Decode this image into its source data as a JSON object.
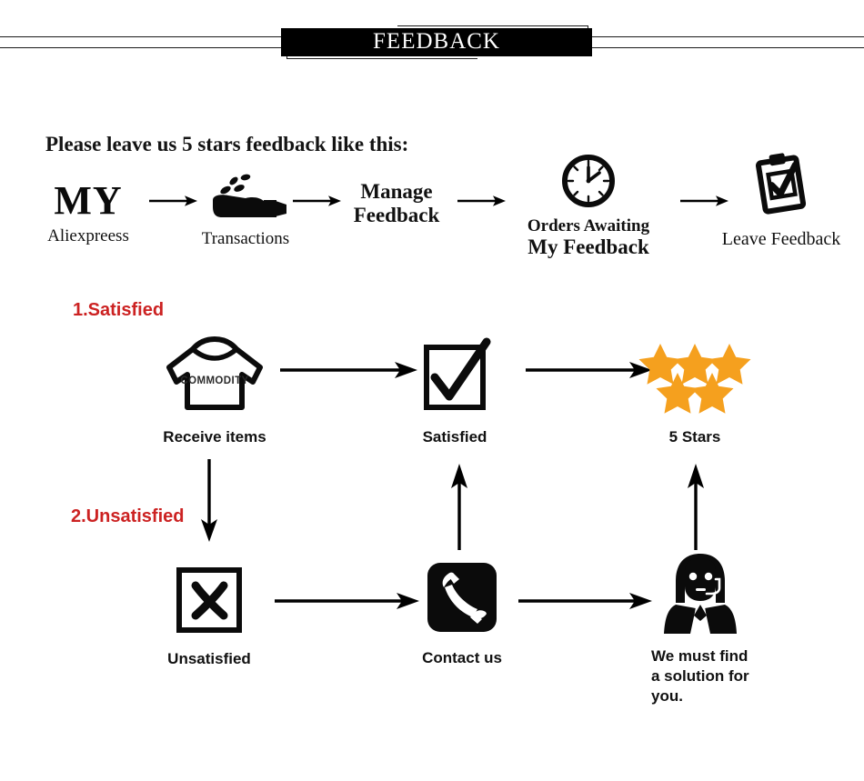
{
  "header": {
    "banner_title": "FEEDBACK"
  },
  "intro": {
    "text": "Please leave us 5 stars feedback like this:"
  },
  "top_flow": {
    "steps": [
      {
        "id": "my-aliexpreess",
        "icon": "my-text-icon",
        "title": "MY",
        "label": "Aliexpreess"
      },
      {
        "id": "transactions",
        "icon": "hand-coins-icon",
        "label": "Transactions"
      },
      {
        "id": "manage-feedback",
        "icon": "none",
        "line1": "Manage",
        "line2": "Feedback"
      },
      {
        "id": "orders-awaiting",
        "icon": "clock-icon",
        "line1": "Orders Awaiting",
        "line2": "My Feedback"
      },
      {
        "id": "leave-feedback",
        "icon": "clipboard-check-icon",
        "label": "Leave Feedback"
      }
    ]
  },
  "branches": {
    "satisfied_tag": "1.Satisfied",
    "unsatisfied_tag": "2.Unsatisfied"
  },
  "satisfied_flow": {
    "steps": [
      {
        "id": "receive-items",
        "icon": "sweater-commodity-icon",
        "icon_text": "COMMODITY",
        "label": "Receive items"
      },
      {
        "id": "satisfied",
        "icon": "checkbox-checked-icon",
        "label": "Satisfied"
      },
      {
        "id": "five-stars",
        "icon": "five-stars-icon",
        "label": "5  Stars"
      }
    ]
  },
  "unsatisfied_flow": {
    "steps": [
      {
        "id": "unsatisfied",
        "icon": "box-x-icon",
        "label": "Unsatisfied"
      },
      {
        "id": "contact-us",
        "icon": "telephone-icon",
        "label": "Contact us"
      },
      {
        "id": "solution",
        "icon": "support-agent-icon",
        "line1": "We must find",
        "line2": "a solution for",
        "line3": "you."
      }
    ]
  },
  "colors": {
    "accent_red": "#cc2222",
    "star_orange": "#f5a01e",
    "ink": "#000000",
    "background": "#ffffff"
  }
}
